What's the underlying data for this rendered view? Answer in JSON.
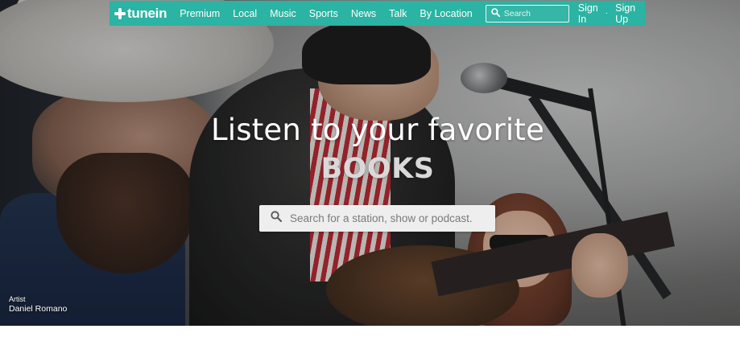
{
  "nav": {
    "logo_text": "tunein",
    "links": [
      "Premium",
      "Local",
      "Music",
      "Sports",
      "News",
      "Talk",
      "By Location"
    ],
    "search_placeholder": "Search",
    "sign_in": "Sign In",
    "separator": "·",
    "sign_up": "Sign Up"
  },
  "hero": {
    "headline": "Listen to your favorite",
    "category": "BOOKS",
    "search_placeholder": "Search for a station, show or podcast."
  },
  "credit": {
    "label": "Artist",
    "name": "Daniel Romano"
  },
  "colors": {
    "nav_background": "#2bb3a3",
    "text": "#ffffff",
    "category_text": "#d9d9d9"
  },
  "icons": {
    "logo": "tunein-plus-logo-icon",
    "nav_search": "search-icon",
    "hero_search": "search-icon"
  }
}
